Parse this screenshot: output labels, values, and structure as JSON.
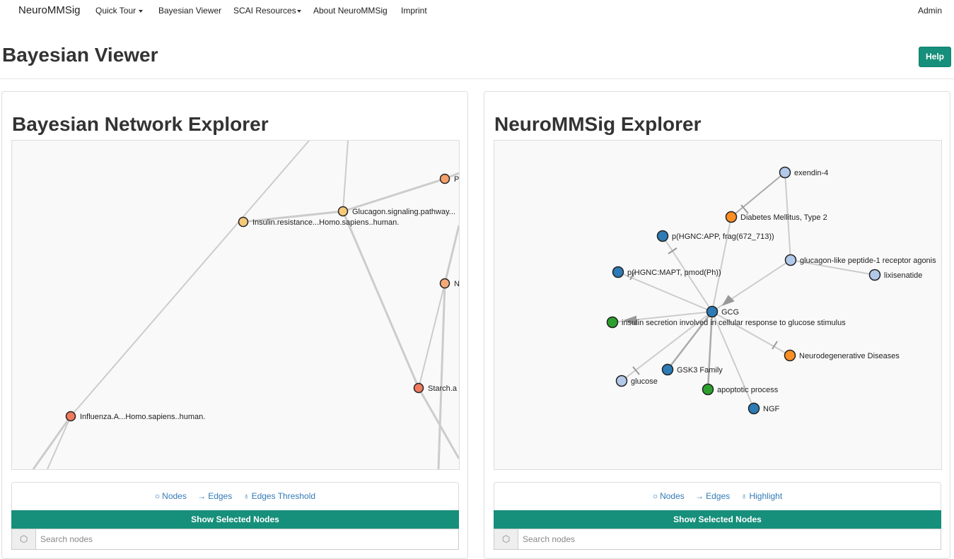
{
  "nav": {
    "brand": "NeuroMMSig",
    "items": [
      {
        "label": "Quick Tour"
      },
      {
        "label": "Bayesian Viewer"
      },
      {
        "label": "SCAI Resources"
      },
      {
        "label": "About NeuroMMSig"
      },
      {
        "label": "Imprint"
      }
    ],
    "admin": "Admin"
  },
  "page": {
    "title": "Bayesian Viewer",
    "help": "Help"
  },
  "colors": {
    "accent": "#168f7b",
    "link": "#337ab7"
  },
  "left_panel": {
    "title": "Bayesian Network Explorer",
    "nodes": [
      {
        "label": "Insulin.resistance...Homo.sapiens..human.",
        "color": "#f5c97a"
      },
      {
        "label": "Glucagon.signaling.pathway...",
        "color": "#f5c97a"
      },
      {
        "label": "P",
        "color": "#f4a06a"
      },
      {
        "label": "N",
        "color": "#f4a97a"
      },
      {
        "label": "Starch.a",
        "color": "#f07a5e"
      },
      {
        "label": "Influenza.A...Homo.sapiens..human.",
        "color": "#f07a5e"
      }
    ],
    "controls": {
      "nodes": "Nodes",
      "edges": "Edges",
      "extra": "Edges Threshold"
    },
    "show_button": "Show Selected Nodes",
    "search_placeholder": "Search nodes"
  },
  "right_panel": {
    "title": "NeuroMMSig Explorer",
    "nodes": [
      {
        "label": "exendin-4",
        "color": "#b3c9ea"
      },
      {
        "label": "Diabetes Mellitus, Type 2",
        "color": "#fd8e23"
      },
      {
        "label": "p(HGNC:APP, frag(672_713))",
        "color": "#2c7bb6"
      },
      {
        "label": "glucagon-like peptide-1 receptor agonis",
        "color": "#b3c9ea"
      },
      {
        "label": "p(HGNC:MAPT, pmod(Ph))",
        "color": "#2c7bb6"
      },
      {
        "label": "lixisenatide",
        "color": "#b3c9ea"
      },
      {
        "label": "GCG",
        "color": "#2c7bb6"
      },
      {
        "label": "insulin secretion involved in cellular response to glucose stimulus",
        "color": "#2ca02c"
      },
      {
        "label": "Neurodegenerative Diseases",
        "color": "#fd8e23"
      },
      {
        "label": "GSK3 Family",
        "color": "#2c7bb6"
      },
      {
        "label": "glucose",
        "color": "#b3c9ea"
      },
      {
        "label": "apoptotic process",
        "color": "#2ca02c"
      },
      {
        "label": "NGF",
        "color": "#2c7bb6"
      }
    ],
    "controls": {
      "nodes": "Nodes",
      "edges": "Edges",
      "extra": "Highlight"
    },
    "show_button": "Show Selected Nodes",
    "search_placeholder": "Search nodes"
  }
}
